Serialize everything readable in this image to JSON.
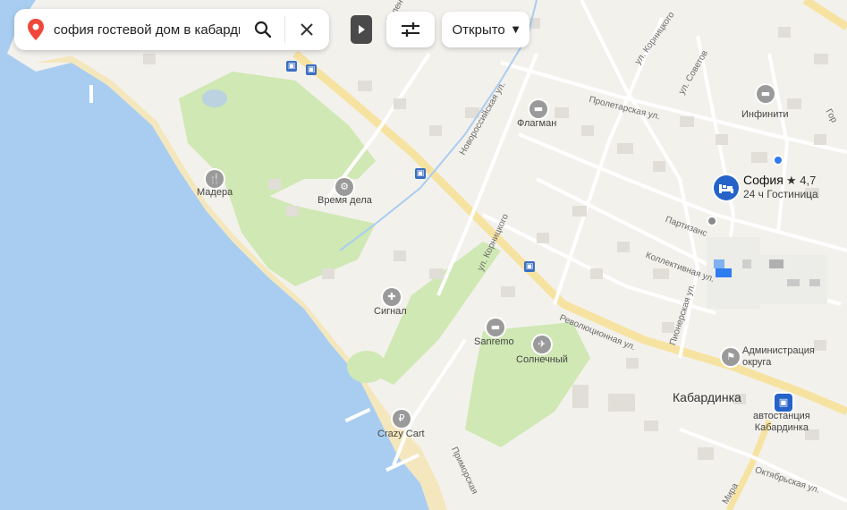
{
  "search": {
    "query": "софия гостевой дом в кабардинке",
    "search_icon": "search-icon",
    "clear_icon": "close-icon",
    "pin_icon": "map-pin-icon"
  },
  "toolbar": {
    "collapse_icon": "play-triangle-icon",
    "filters_icon": "sliders-icon",
    "open_label": "Открыто",
    "open_caret": "▼"
  },
  "hotel": {
    "name": "София",
    "rating": "★ 4,7",
    "subtitle": "24 ч  Гостиница",
    "icon": "bed-icon",
    "accent": "#2563c9"
  },
  "places": {
    "madera": "Мадера",
    "vremya_dela": "Время дела",
    "signal": "Сигнал",
    "sanremo": "Sanremo",
    "solnechny": "Солнечный",
    "crazy_cart": "Crazy Cart",
    "flagman": "Флагман",
    "infiniti": "Инфинити",
    "admin": "Администрация\nокруга",
    "kabardinka": "Кабардинка",
    "bus_station": "автостанция\nКабардинка"
  },
  "roads": {
    "revolyutsionnaya": "Революционная ул.",
    "kolektivnaya": "Коллективная ул.",
    "partizanskaya": "Партизанс",
    "proletarskaya": "Пролетарская ул.",
    "novorossiyskaya": "Новороссийская ул.",
    "kornitskogo1": "ул. Корницкого",
    "kornitskogo2": "ул. Корницкого",
    "sovetov": "ул. Советов",
    "pionerskaya": "Пионерская ул.",
    "oktyabrskaya": "Октябрьская ул.",
    "mira": "Мира",
    "primorskaya": "Приморская",
    "zelenaya": "Зелен",
    "gor": "Гор"
  },
  "colors": {
    "water": "#a8cdf0",
    "land": "#f3f1ec",
    "park": "#cfe8b4",
    "main_road": "#f7e3a1",
    "beach": "#f5e7bd"
  }
}
